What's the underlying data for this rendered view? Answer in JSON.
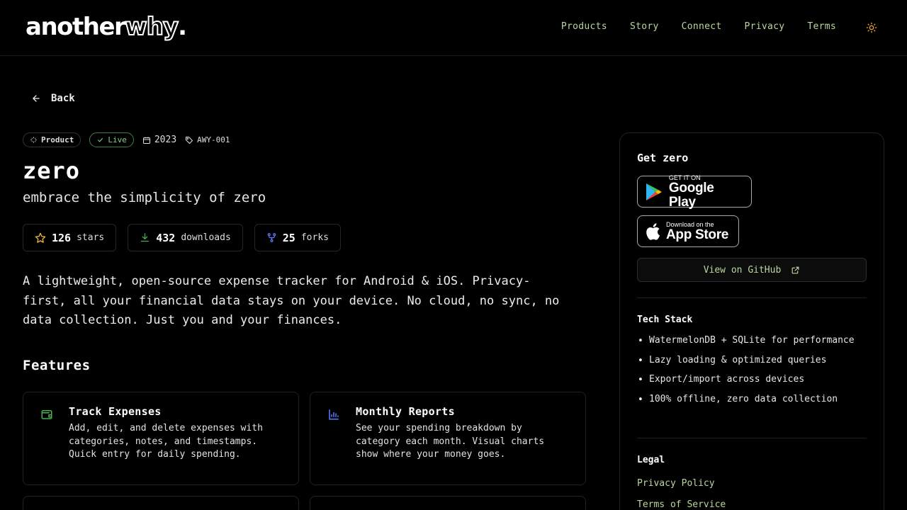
{
  "header": {
    "logo_main": "another",
    "logo_accent": "why",
    "logo_dot": ".",
    "nav": [
      "Products",
      "Story",
      "Connect",
      "Privacy",
      "Terms"
    ],
    "theme_icon": "sun-icon",
    "accent_color": "#b9d79e"
  },
  "back": {
    "label": "Back",
    "icon": "arrow-left-icon"
  },
  "meta": {
    "type_label": "Product",
    "status_label": "Live",
    "year": "2023",
    "code": "AWY-001"
  },
  "product": {
    "name": "zero",
    "tagline": "embrace the simplicity of zero",
    "description": "A lightweight, open-source expense tracker for Android & iOS. Privacy-first, all your financial data stays on your device. No cloud, no sync, no data collection. Just you and your finances."
  },
  "stats": [
    {
      "value": "126",
      "label": "stars",
      "icon": "star-icon",
      "color": "#e8b43a"
    },
    {
      "value": "432",
      "label": "downloads",
      "icon": "download-icon",
      "color": "#4caf50"
    },
    {
      "value": "25",
      "label": "forks",
      "icon": "fork-icon",
      "color": "#5a7cff"
    }
  ],
  "features": {
    "heading": "Features",
    "items": [
      {
        "title": "Track Expenses",
        "text": "Add, edit, and delete expenses with categories, notes, and timestamps. Quick entry for daily spending.",
        "icon": "wallet-icon"
      },
      {
        "title": "Monthly Reports",
        "text": "See your spending breakdown by category each month. Visual charts show where your money goes.",
        "icon": "bar-chart-icon"
      }
    ]
  },
  "sidebar": {
    "get_heading": "Get zero",
    "google_small": "GET IT ON",
    "google_big": "Google Play",
    "apple_small": "Download on the",
    "apple_big": "App Store",
    "github_label": "View on GitHub",
    "tech_heading": "Tech Stack",
    "tech": [
      "WatermelonDB + SQLite for performance",
      "Lazy loading & optimized queries",
      "Export/import across devices",
      "100% offline, zero data collection"
    ],
    "legal_heading": "Legal",
    "legal_links": [
      "Privacy Policy",
      "Terms of Service"
    ]
  }
}
